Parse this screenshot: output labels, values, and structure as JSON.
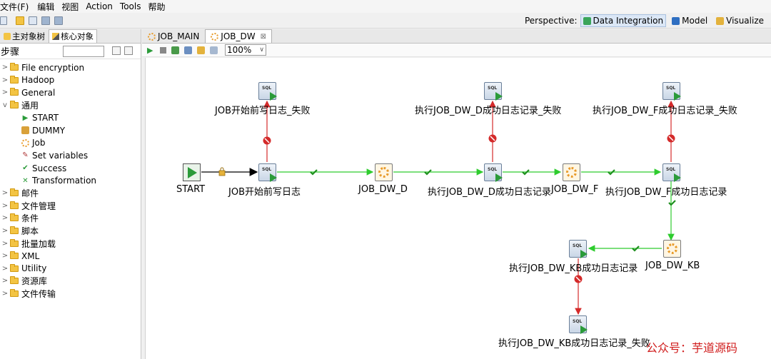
{
  "menu": [
    "文件(F)",
    "编辑",
    "视图",
    "Action",
    "Tools",
    "帮助"
  ],
  "perspective": {
    "label": "Perspective:",
    "items": [
      {
        "label": "Data Integration",
        "active": true
      },
      {
        "label": "Model",
        "active": false
      },
      {
        "label": "Visualize",
        "active": false
      }
    ]
  },
  "left_tabs": [
    "主对象树",
    "核心对象"
  ],
  "steps_label": "步骤",
  "tree": [
    {
      "label": "File encryption",
      "expanded": false
    },
    {
      "label": "Hadoop",
      "expanded": false
    },
    {
      "label": "General",
      "expanded": false
    },
    {
      "label": "通用",
      "expanded": true,
      "children": [
        {
          "label": "START",
          "icon": "play-icon"
        },
        {
          "label": "DUMMY",
          "icon": "dummy-icon"
        },
        {
          "label": "Job",
          "icon": "job-icon"
        },
        {
          "label": "Set variables",
          "icon": "tag-icon"
        },
        {
          "label": "Success",
          "icon": "checkmark-icon"
        },
        {
          "label": "Transformation",
          "icon": "transformation-icon"
        }
      ]
    },
    {
      "label": "邮件",
      "expanded": false
    },
    {
      "label": "文件管理",
      "expanded": false
    },
    {
      "label": "条件",
      "expanded": false
    },
    {
      "label": "脚本",
      "expanded": false
    },
    {
      "label": "批量加载",
      "expanded": false
    },
    {
      "label": "XML",
      "expanded": false
    },
    {
      "label": "Utility",
      "expanded": false
    },
    {
      "label": "资源库",
      "expanded": false
    },
    {
      "label": "文件传输",
      "expanded": false
    }
  ],
  "editor_tabs": [
    {
      "label": "JOB_MAIN",
      "active": false,
      "closable": false
    },
    {
      "label": "JOB_DW",
      "active": true,
      "closable": true
    }
  ],
  "zoom": "100%",
  "nodes": {
    "start": "START",
    "log_begin": "JOB开始前写日志",
    "log_begin_fail": "JOB开始前写日志_失败",
    "job_dw_d": "JOB_DW_D",
    "log_dw_d": "执行JOB_DW_D成功日志记录",
    "log_dw_d_fail": "执行JOB_DW_D成功日志记录_失败",
    "job_dw_f": "JOB_DW_F",
    "log_dw_f": "执行JOB_DW_F成功日志记录",
    "log_dw_f_fail": "执行JOB_DW_F成功日志记录_失败",
    "job_dw_kb": "JOB_DW_KB",
    "log_dw_kb": "执行JOB_DW_KB成功日志记录",
    "log_dw_kb_fail": "执行JOB_DW_KB成功日志记录_失败"
  },
  "icons": {
    "sql": "SQL"
  },
  "watermark": "公众号：芋道源码",
  "colors": {
    "success_hop": "#2ecc2e",
    "fail_hop": "#d42a2a",
    "folder": "#f3c443"
  }
}
